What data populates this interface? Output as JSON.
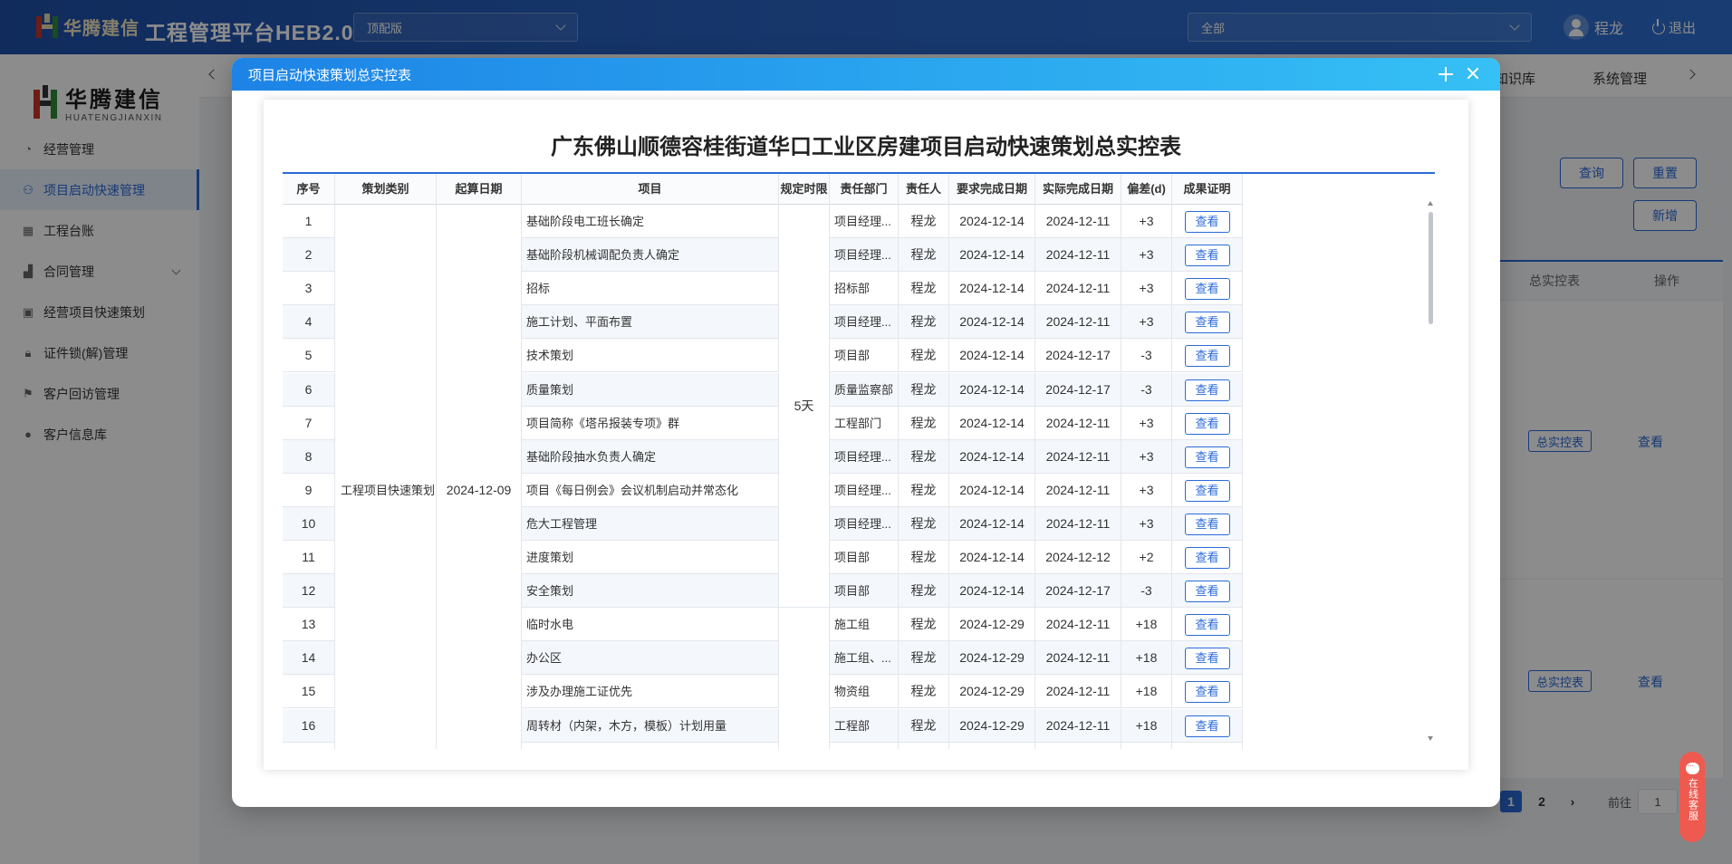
{
  "header": {
    "logo_text": "华腾建信",
    "app_title": "工程管理平台HEB2.0",
    "version_select": "顶配版",
    "scope_select": "全部",
    "user_name": "程龙",
    "logout_label": "退出"
  },
  "sidebar": {
    "logo_cn": "华腾建信",
    "logo_en": "HUATENGJIANXIN",
    "items": [
      {
        "label": "经营管理",
        "icon": "pie-chart-icon"
      },
      {
        "label": "项目启动快速管理",
        "icon": "users-icon",
        "active": true
      },
      {
        "label": "工程台账",
        "icon": "grid-icon"
      },
      {
        "label": "合同管理",
        "icon": "briefcase-icon",
        "has_children": true
      },
      {
        "label": "经营项目快速策划",
        "icon": "clipboard-icon"
      },
      {
        "label": "证件锁(解)管理",
        "icon": "lock-icon"
      },
      {
        "label": "客户回访管理",
        "icon": "flag-icon"
      },
      {
        "label": "客户信息库",
        "icon": "person-icon"
      }
    ]
  },
  "tabs_bar": {
    "partial_link": "知识库",
    "system_link": "系统管理"
  },
  "actions": {
    "query": "查询",
    "reset": "重置",
    "add": "新增"
  },
  "bg_table": {
    "col_summary": "总实控表",
    "col_action": "操作",
    "rows": [
      {
        "tag": "总实控表",
        "link": "查看"
      },
      {
        "tag": "总实控表",
        "link": "查看"
      }
    ]
  },
  "pagination": {
    "pages": [
      "1",
      "2"
    ],
    "current": "1",
    "goto_label": "前往",
    "goto_value": "1"
  },
  "chat_widget": "在线客服",
  "modal": {
    "title": "项目启动快速策划总实控表",
    "doc_title": "广东佛山顺德容桂街道华口工业区房建项目启动快速策划总实控表",
    "columns": [
      "序号",
      "策划类别",
      "起算日期",
      "项目",
      "规定时限",
      "责任部门",
      "责任人",
      "要求完成日期",
      "实际完成日期",
      "偏差(d)",
      "成果证明"
    ],
    "category": "工程项目快速策划",
    "start_date": "2024-12-09",
    "time_limit_group1": "5天",
    "view_label": "查看",
    "rows": [
      {
        "no": "1",
        "item": "基础阶段电工班长确定",
        "dept": "项目经理...",
        "owner": "程龙",
        "due": "2024-12-14",
        "actual": "2024-12-11",
        "dev": "+3"
      },
      {
        "no": "2",
        "item": "基础阶段机械调配负责人确定",
        "dept": "项目经理...",
        "owner": "程龙",
        "due": "2024-12-14",
        "actual": "2024-12-11",
        "dev": "+3"
      },
      {
        "no": "3",
        "item": "招标",
        "dept": "招标部",
        "owner": "程龙",
        "due": "2024-12-14",
        "actual": "2024-12-11",
        "dev": "+3"
      },
      {
        "no": "4",
        "item": "施工计划、平面布置",
        "dept": "项目经理...",
        "owner": "程龙",
        "due": "2024-12-14",
        "actual": "2024-12-11",
        "dev": "+3"
      },
      {
        "no": "5",
        "item": "技术策划",
        "dept": "项目部",
        "owner": "程龙",
        "due": "2024-12-14",
        "actual": "2024-12-17",
        "dev": "-3"
      },
      {
        "no": "6",
        "item": "质量策划",
        "dept": "质量监察部",
        "owner": "程龙",
        "due": "2024-12-14",
        "actual": "2024-12-17",
        "dev": "-3"
      },
      {
        "no": "7",
        "item": "项目简称《塔吊报装专项》群",
        "dept": "工程部门",
        "owner": "程龙",
        "due": "2024-12-14",
        "actual": "2024-12-11",
        "dev": "+3"
      },
      {
        "no": "8",
        "item": "基础阶段抽水负责人确定",
        "dept": "项目经理...",
        "owner": "程龙",
        "due": "2024-12-14",
        "actual": "2024-12-11",
        "dev": "+3"
      },
      {
        "no": "9",
        "item": "项目《每日例会》会议机制启动并常态化",
        "dept": "项目经理...",
        "owner": "程龙",
        "due": "2024-12-14",
        "actual": "2024-12-11",
        "dev": "+3"
      },
      {
        "no": "10",
        "item": "危大工程管理",
        "dept": "项目经理...",
        "owner": "程龙",
        "due": "2024-12-14",
        "actual": "2024-12-11",
        "dev": "+3"
      },
      {
        "no": "11",
        "item": "进度策划",
        "dept": "项目部",
        "owner": "程龙",
        "due": "2024-12-14",
        "actual": "2024-12-12",
        "dev": "+2"
      },
      {
        "no": "12",
        "item": "安全策划",
        "dept": "项目部",
        "owner": "程龙",
        "due": "2024-12-14",
        "actual": "2024-12-17",
        "dev": "-3"
      },
      {
        "no": "13",
        "item": "临时水电",
        "dept": "施工组",
        "owner": "程龙",
        "due": "2024-12-29",
        "actual": "2024-12-11",
        "dev": "+18"
      },
      {
        "no": "14",
        "item": "办公区",
        "dept": "施工组、...",
        "owner": "程龙",
        "due": "2024-12-29",
        "actual": "2024-12-11",
        "dev": "+18"
      },
      {
        "no": "15",
        "item": "涉及办理施工证优先",
        "dept": "物资组",
        "owner": "程龙",
        "due": "2024-12-29",
        "actual": "2024-12-11",
        "dev": "+18"
      },
      {
        "no": "16",
        "item": "周转材（内架，木方，模板）计划用量",
        "dept": "工程部",
        "owner": "程龙",
        "due": "2024-12-29",
        "actual": "2024-12-11",
        "dev": "+18"
      },
      {
        "no": "",
        "item": "",
        "dept": "",
        "owner": "",
        "due": "",
        "actual": "",
        "dev": ""
      }
    ]
  }
}
